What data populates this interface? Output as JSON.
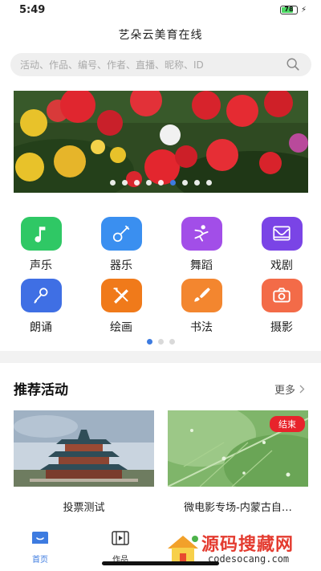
{
  "status": {
    "time": "5:49",
    "battery": "78",
    "battery_level": 0.78
  },
  "app": {
    "title": "艺朵云美育在线"
  },
  "search": {
    "placeholder": "活动、作品、编号、作者、直播、昵称、ID"
  },
  "banner": {
    "dot_count": 9,
    "active_index": 5
  },
  "categories": [
    {
      "label": "声乐",
      "icon": "music-note-icon",
      "color": "#2fc865"
    },
    {
      "label": "器乐",
      "icon": "guitar-icon",
      "color": "#3a8ff0"
    },
    {
      "label": "舞蹈",
      "icon": "dance-icon",
      "color": "#a24ee8"
    },
    {
      "label": "戏剧",
      "icon": "drama-icon",
      "color": "#7a44e6"
    },
    {
      "label": "朗诵",
      "icon": "microphone-icon",
      "color": "#3f6fe4"
    },
    {
      "label": "绘画",
      "icon": "pencil-brush-icon",
      "color": "#f07a1a"
    },
    {
      "label": "书法",
      "icon": "brush-icon",
      "color": "#f3862f"
    },
    {
      "label": "摄影",
      "icon": "camera-icon",
      "color": "#f36b48"
    }
  ],
  "category_pager": {
    "dot_count": 3,
    "active_index": 0
  },
  "recommended": {
    "title": "推荐活动",
    "more_label": "更多",
    "cards": [
      {
        "title": "投票测试"
      },
      {
        "title": "微电影专场-内蒙古自…",
        "badge": "结束"
      }
    ]
  },
  "tabbar": {
    "tabs": [
      {
        "label": "首页",
        "icon": "home-icon",
        "active": true
      },
      {
        "label": "作品",
        "icon": "film-icon",
        "active": false
      }
    ]
  },
  "watermark": {
    "title": "源码搜藏网",
    "subtitle": "codesocang.com"
  },
  "colors": {
    "accent": "#3d7be0",
    "badge": "#e8232b"
  }
}
